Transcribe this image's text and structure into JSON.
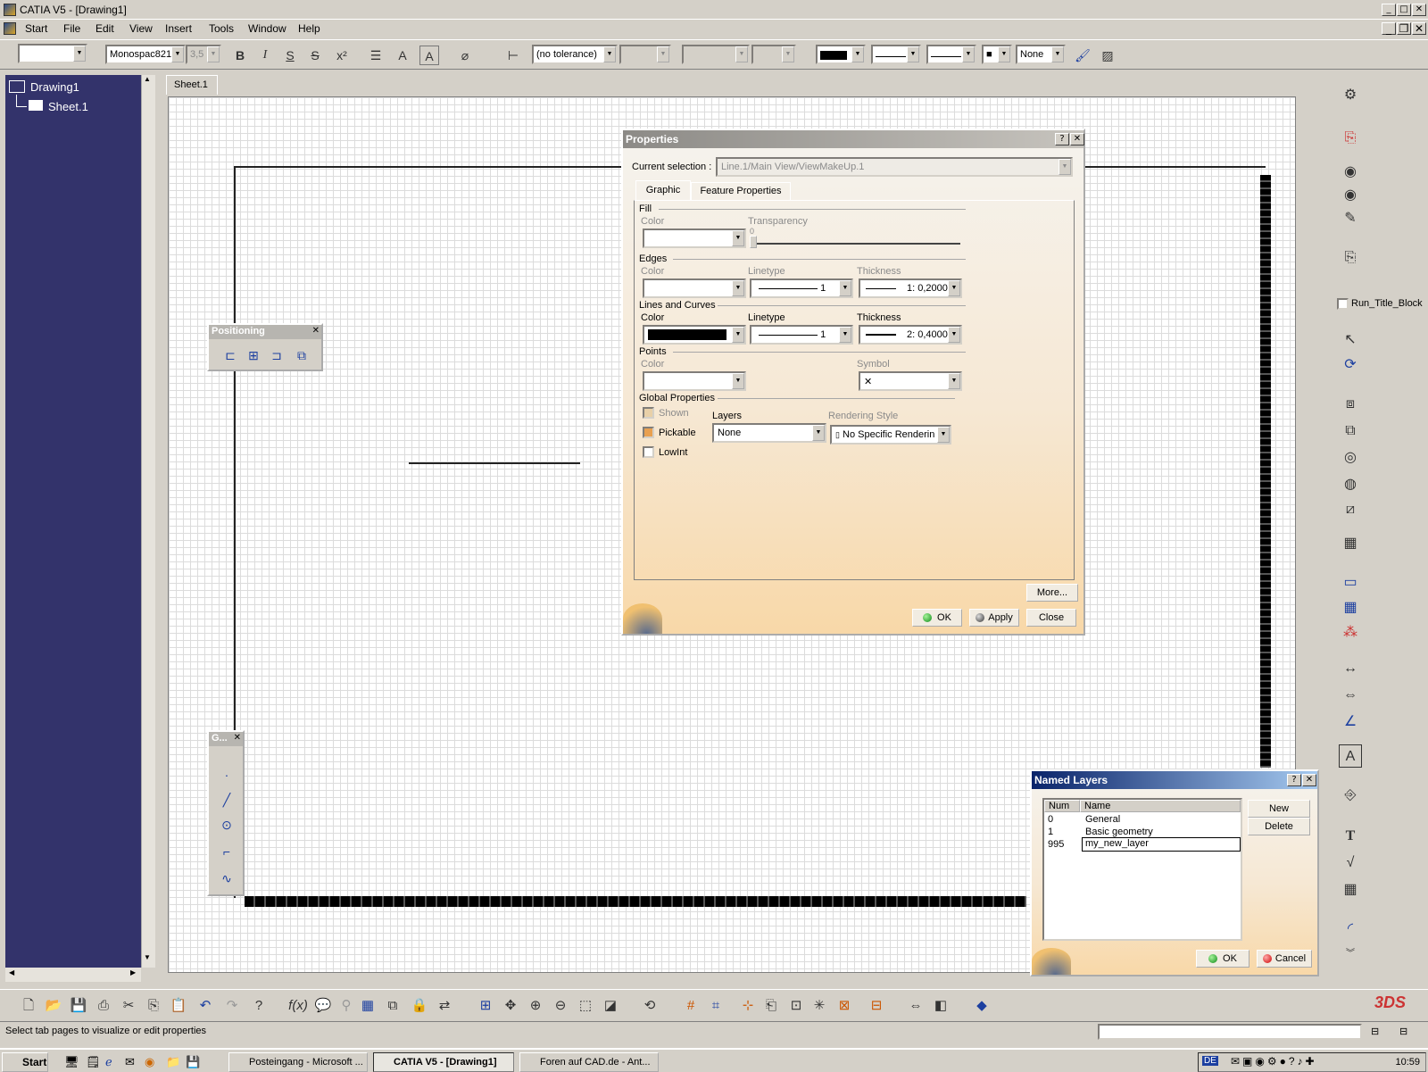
{
  "window": {
    "title": "CATIA V5 - [Drawing1]"
  },
  "menu": [
    "Start",
    "File",
    "Edit",
    "View",
    "Insert",
    "Tools",
    "Window",
    "Help"
  ],
  "toolbar": {
    "font_name": "Monospac821",
    "font_size": "3,5",
    "tolerance": "(no tolerance)",
    "pattern": "None",
    "icons": [
      "bold-icon",
      "italic-icon",
      "underline-icon",
      "strikethrough-icon",
      "superscript-icon",
      "align-icon",
      "frame-text-icon",
      "insert-symbol-icon",
      "dimension-icon",
      "fill-color-icon",
      "linetype-icon",
      "thickness-icon",
      "point-icon",
      "painter-icon",
      "hatch-icon"
    ]
  },
  "tree": {
    "root": "Drawing1",
    "child": "Sheet.1"
  },
  "sheet_tab": "Sheet.1",
  "positioning": {
    "title": "Positioning",
    "icons": [
      "align-left-icon",
      "align-center-icon",
      "align-right-icon",
      "fit-frame-icon"
    ]
  },
  "geometry_bar": {
    "title": "G...",
    "icons": [
      "point-icon",
      "line-icon",
      "circle-icon",
      "profile-icon",
      "curve-icon"
    ]
  },
  "properties": {
    "title": "Properties",
    "current_selection_label": "Current selection :",
    "current_selection": "Line.1/Main View/ViewMakeUp.1",
    "tabs": [
      "Graphic",
      "Feature Properties"
    ],
    "fill": {
      "section": "Fill",
      "color_label": "Color",
      "transparency_label": "Transparency",
      "transparency_value": "0"
    },
    "edges": {
      "section": "Edges",
      "color_label": "Color",
      "linetype_label": "Linetype",
      "linetype": "1",
      "thickness_label": "Thickness",
      "thickness": "1: 0,2000"
    },
    "lines": {
      "section": "Lines and Curves",
      "color_label": "Color",
      "linetype_label": "Linetype",
      "linetype": "1",
      "thickness_label": "Thickness",
      "thickness": "2: 0,4000"
    },
    "points": {
      "section": "Points",
      "color_label": "Color",
      "symbol_label": "Symbol",
      "symbol": "✕"
    },
    "global": {
      "section": "Global Properties",
      "shown": "Shown",
      "pickable": "Pickable",
      "lowint": "LowInt",
      "layers_label": "Layers",
      "layer": "None",
      "rendering_label": "Rendering Style",
      "rendering": "No Specific Renderin"
    },
    "buttons": {
      "more": "More...",
      "ok": "OK",
      "apply": "Apply",
      "close": "Close"
    }
  },
  "named_layers": {
    "title": "Named Layers",
    "columns": [
      "Num",
      "Name"
    ],
    "rows": [
      {
        "num": "0",
        "name": "General"
      },
      {
        "num": "1",
        "name": "Basic geometry"
      },
      {
        "num": "995",
        "name": "my_new_layer"
      }
    ],
    "buttons": {
      "new": "New",
      "delete": "Delete",
      "ok": "OK",
      "cancel": "Cancel"
    }
  },
  "right_toolbar": {
    "run_title_block": "Run_Title_Block"
  },
  "status": {
    "text": "Select tab pages to visualize or edit properties"
  },
  "taskbar": {
    "start": "Start",
    "items": [
      "Posteingang - Microsoft ...",
      "CATIA V5 - [Drawing1]",
      "Foren auf CAD.de - Ant..."
    ],
    "lang": "DE",
    "clock": "10:59"
  },
  "colors": {
    "tree_bg": "#33336b",
    "dialog_title": "#0a246a",
    "accent": "#0a246a"
  }
}
